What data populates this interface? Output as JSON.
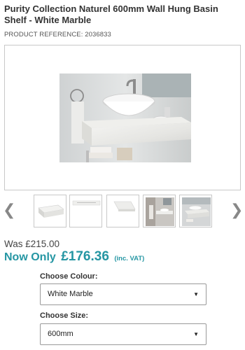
{
  "product": {
    "title": "Purity Collection Naturel 600mm Wall Hung Basin Shelf - White Marble",
    "reference": "PRODUCT REFERENCE: 2036833"
  },
  "gallery": {
    "prev_icon": "chevron-left-icon",
    "next_icon": "chevron-right-icon",
    "prev_glyph": "❮",
    "next_glyph": "❯"
  },
  "pricing": {
    "was": "Was £215.00",
    "now_label": "Now Only",
    "now_price": "£176.36",
    "vat_note": "(inc. VAT)",
    "accent_color": "#2596a3"
  },
  "options": {
    "colour_label": "Choose Colour:",
    "colour_value": "White Marble",
    "size_label": "Choose Size:",
    "size_value": "600mm",
    "caret": "▼"
  }
}
